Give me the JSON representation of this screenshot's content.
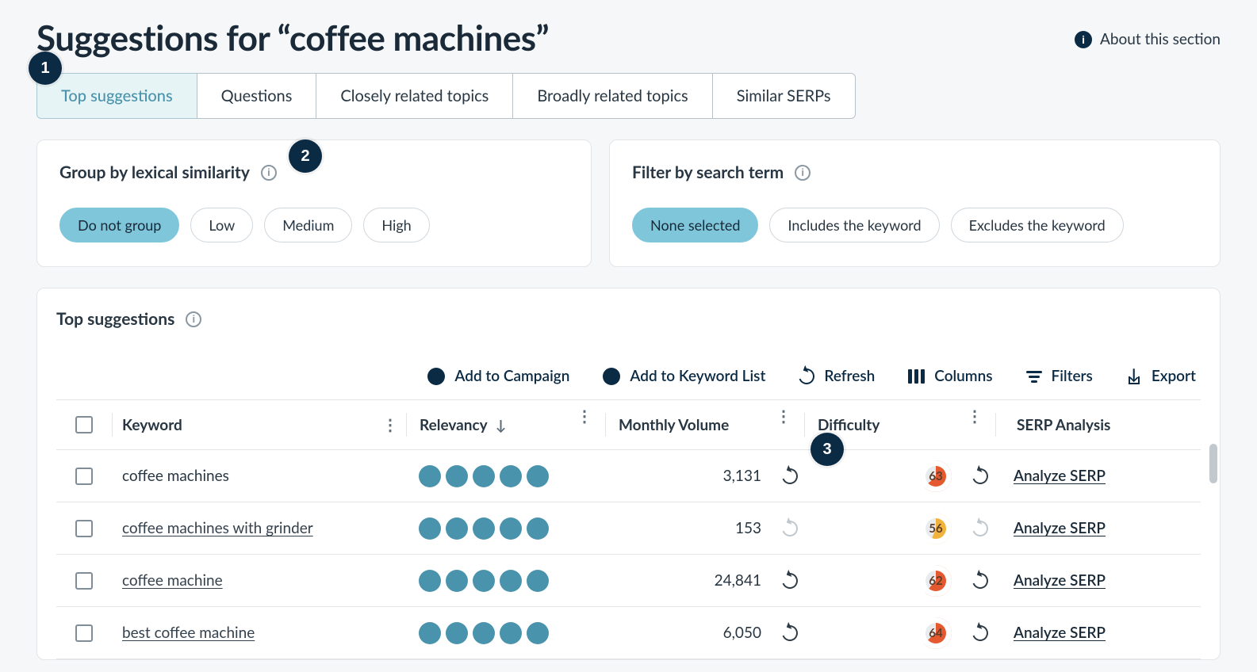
{
  "header": {
    "title": "Suggestions for “coffee machines”",
    "about_label": "About this section"
  },
  "tabs": [
    {
      "label": "Top suggestions",
      "active": true
    },
    {
      "label": "Questions",
      "active": false
    },
    {
      "label": "Closely related topics",
      "active": false
    },
    {
      "label": "Broadly related topics",
      "active": false
    },
    {
      "label": "Similar SERPs",
      "active": false
    }
  ],
  "group_card": {
    "title": "Group by lexical similarity",
    "options": [
      {
        "label": "Do not group",
        "selected": true
      },
      {
        "label": "Low",
        "selected": false
      },
      {
        "label": "Medium",
        "selected": false
      },
      {
        "label": "High",
        "selected": false
      }
    ]
  },
  "filter_card": {
    "title": "Filter by search term",
    "options": [
      {
        "label": "None selected",
        "selected": true
      },
      {
        "label": "Includes the keyword",
        "selected": false
      },
      {
        "label": "Excludes the keyword",
        "selected": false
      }
    ]
  },
  "section_title": "Top suggestions",
  "toolbar": {
    "add_campaign": "Add to Campaign",
    "add_list": "Add to Keyword List",
    "refresh": "Refresh",
    "columns": "Columns",
    "filters": "Filters",
    "export": "Export"
  },
  "columns": {
    "keyword": "Keyword",
    "relevancy": "Relevancy",
    "volume": "Monthly Volume",
    "difficulty": "Difficulty",
    "serp": "SERP Analysis"
  },
  "serp_link_label": "Analyze SERP",
  "rows": [
    {
      "keyword": "coffee machines",
      "link": false,
      "relevancy": 5,
      "volume": "3,131",
      "vol_dim": false,
      "difficulty": 63,
      "diff_color": "#e4592f",
      "diff_dim": false
    },
    {
      "keyword": "coffee machines with grinder",
      "link": true,
      "relevancy": 5,
      "volume": "153",
      "vol_dim": true,
      "difficulty": 56,
      "diff_color": "#f1b33c",
      "diff_dim": true
    },
    {
      "keyword": "coffee machine",
      "link": true,
      "relevancy": 5,
      "volume": "24,841",
      "vol_dim": false,
      "difficulty": 62,
      "diff_color": "#e4592f",
      "diff_dim": false
    },
    {
      "keyword": "best coffee machine",
      "link": true,
      "relevancy": 5,
      "volume": "6,050",
      "vol_dim": false,
      "difficulty": 64,
      "diff_color": "#e4592f",
      "diff_dim": false
    }
  ],
  "annotations": {
    "a1": "1",
    "a2": "2",
    "a3": "3"
  }
}
